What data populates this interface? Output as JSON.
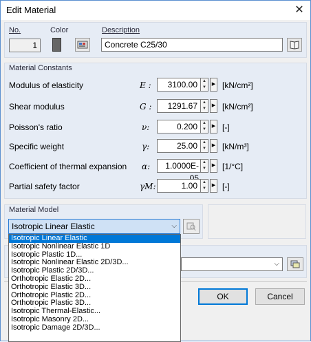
{
  "window": {
    "title": "Edit Material",
    "close_glyph": "✕"
  },
  "header": {
    "no_label": "No.",
    "no_value": "1",
    "color_label": "Color",
    "color_value": "#666666",
    "description_label": "Description",
    "description_value": "Concrete C25/30"
  },
  "constants": {
    "title": "Material Constants",
    "rows": [
      {
        "label": "Modulus of elasticity",
        "symbol": "E :",
        "value": "3100.00",
        "unit": "[kN/cm²]"
      },
      {
        "label": "Shear modulus",
        "symbol": "G :",
        "value": "1291.67",
        "unit": "[kN/cm²]"
      },
      {
        "label": "Poisson's ratio",
        "symbol": "ν:",
        "value": "0.200",
        "unit": "[-]"
      },
      {
        "label": "Specific weight",
        "symbol": "γ:",
        "value": "25.00",
        "unit": "[kN/m³]"
      },
      {
        "label": "Coefficient of thermal expansion",
        "symbol": "α:",
        "value": "1.0000E-05",
        "unit": "[1/°C]"
      },
      {
        "label": "Partial safety factor",
        "symbol": "γM:",
        "value": "1.00",
        "unit": "[-]"
      }
    ]
  },
  "model": {
    "title": "Material Model",
    "selected": "Isotropic Linear Elastic",
    "options": [
      "Isotropic Linear Elastic",
      "Isotropic Nonlinear Elastic 1D",
      "Isotropic Plastic 1D...",
      "Isotropic Nonlinear Elastic 2D/3D...",
      "Isotropic Plastic 2D/3D...",
      "Orthotropic Elastic 2D...",
      "Orthotropic Elastic 3D...",
      "Orthotropic Plastic 2D...",
      "Orthotropic Plastic 3D...",
      "Isotropic Thermal-Elastic...",
      "Isotropic Masonry 2D...",
      "Isotropic Damage 2D/3D..."
    ]
  },
  "footer": {
    "ok_label": "OK",
    "cancel_label": "Cancel"
  }
}
